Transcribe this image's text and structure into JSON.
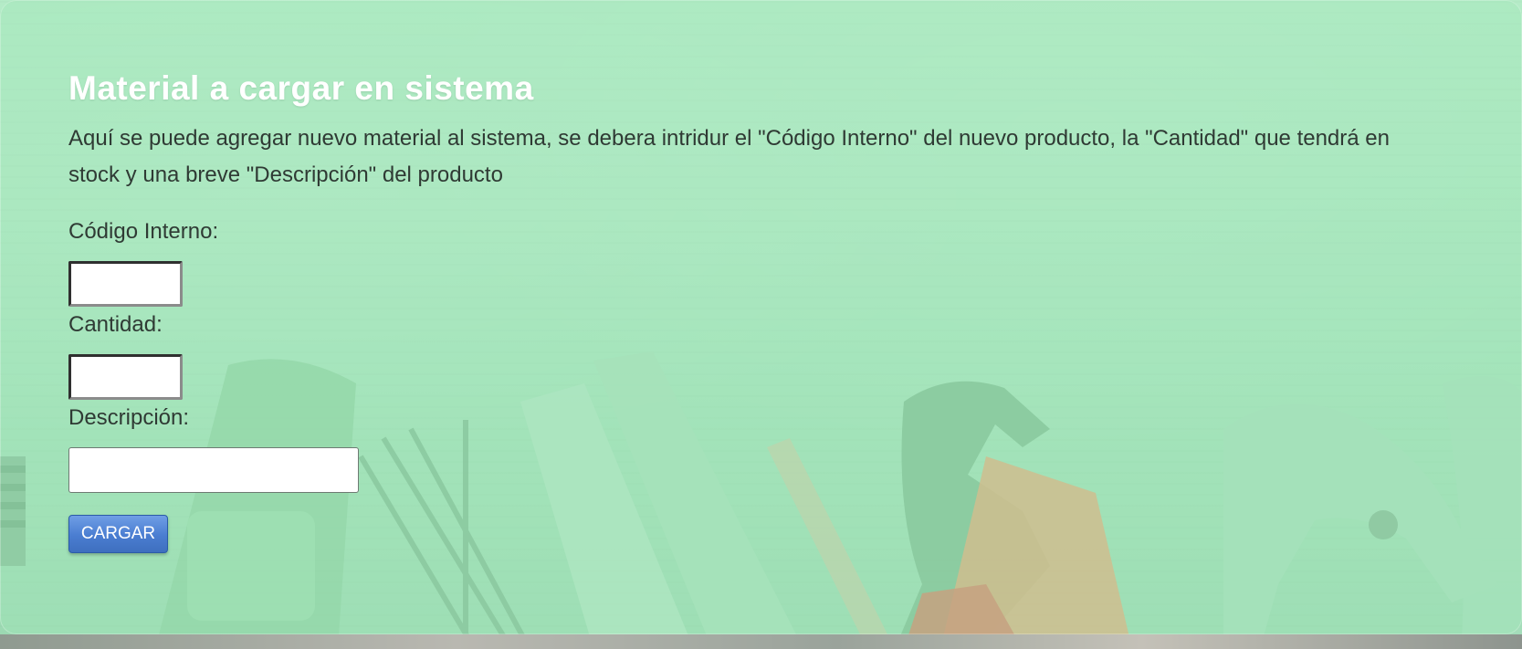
{
  "page": {
    "title": "Material a cargar en sistema",
    "description": "Aquí se puede agregar nuevo material al sistema, se debera intridur el \"Código Interno\" del nuevo producto, la \"Cantidad\" que tendrá en stock y una breve \"Descripción\" del producto"
  },
  "form": {
    "codigo_label": "Código Interno:",
    "cantidad_label": "Cantidad:",
    "descripcion_label": "Descripción:",
    "codigo_value": "",
    "cantidad_value": "",
    "descripcion_value": "",
    "submit_label": "CARGAR"
  },
  "colors": {
    "overlay_green": "#a6e3bc",
    "button_blue": "#4a7dd1",
    "title_white": "#ffffff"
  },
  "icons": {
    "background": "tools-background-image"
  }
}
